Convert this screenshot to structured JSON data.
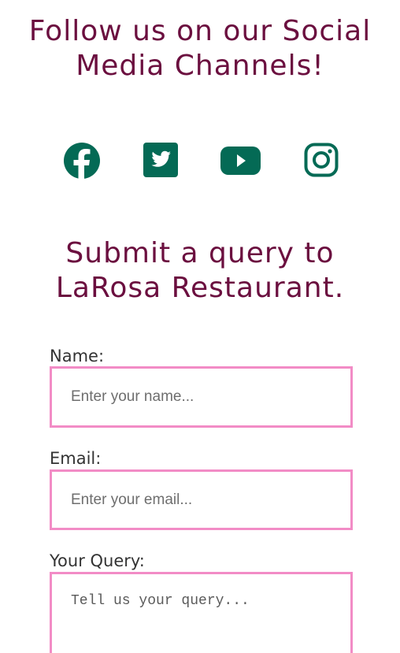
{
  "social": {
    "heading_line1": "Follow us on our Social",
    "heading_line2": "Media Channels!",
    "icon_color": "#046a55",
    "links": [
      {
        "name": "facebook",
        "icon": "facebook-icon"
      },
      {
        "name": "twitter",
        "icon": "twitter-icon"
      },
      {
        "name": "youtube",
        "icon": "youtube-icon"
      },
      {
        "name": "instagram",
        "icon": "instagram-icon"
      }
    ]
  },
  "query": {
    "heading_line1": "Submit a query to",
    "heading_line2": "LaRosa Restaurant.",
    "heading_color": "#6b0f3f",
    "field_border_color": "#f28cc6",
    "fields": {
      "name": {
        "label": "Name:",
        "placeholder": "Enter your name...",
        "value": ""
      },
      "email": {
        "label": "Email:",
        "placeholder": "Enter your email...",
        "value": ""
      },
      "query": {
        "label": "Your Query:",
        "placeholder": "Tell us your query...",
        "value": ""
      }
    }
  }
}
